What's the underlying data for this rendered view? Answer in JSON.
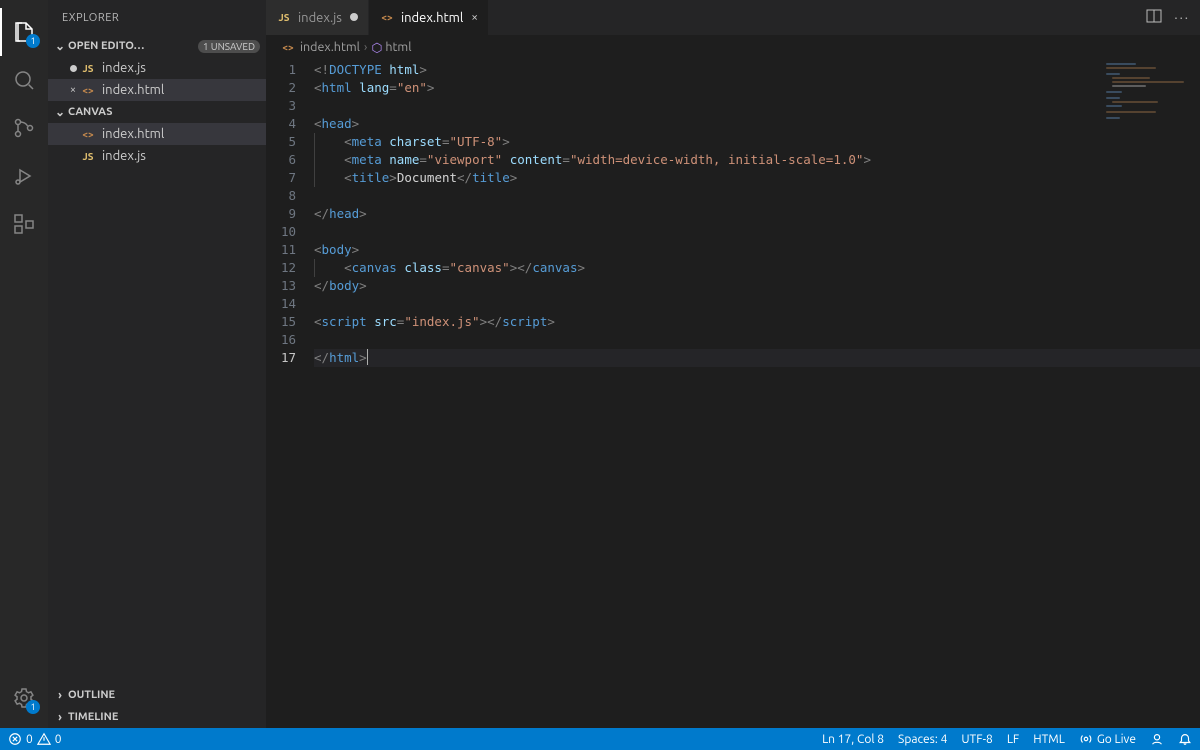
{
  "sidebar": {
    "title": "EXPLORER",
    "sections": {
      "open_editors": {
        "label": "OPEN EDITO…",
        "pill": "1 UNSAVED"
      },
      "workspace": {
        "label": "CANVAS"
      },
      "outline": {
        "label": "OUTLINE"
      },
      "timeline": {
        "label": "TIMELINE"
      }
    },
    "open_editors_items": [
      {
        "name": "index.js",
        "icon": "js",
        "dirty": true,
        "active": false
      },
      {
        "name": "index.html",
        "icon": "html",
        "dirty": false,
        "active": true
      }
    ],
    "workspace_items": [
      {
        "name": "index.html",
        "icon": "html",
        "active": true
      },
      {
        "name": "index.js",
        "icon": "js",
        "active": false
      }
    ]
  },
  "activity_badges": {
    "explorer": "1",
    "settings": "1"
  },
  "tabs": [
    {
      "name": "index.js",
      "icon": "js",
      "dirty": true,
      "active": false
    },
    {
      "name": "index.html",
      "icon": "html",
      "dirty": false,
      "active": true
    }
  ],
  "breadcrumbs": {
    "file": "index.html",
    "symbol": "html"
  },
  "editor": {
    "line_count": 17,
    "current_line": 17,
    "lines": {
      "1": {
        "t": "doctype",
        "text": "<!DOCTYPE html>"
      },
      "2": {
        "t": "open",
        "tag": "html",
        "attrs": [
          [
            "lang",
            "en"
          ]
        ]
      },
      "3": {
        "t": "blank"
      },
      "4": {
        "t": "open",
        "tag": "head"
      },
      "5": {
        "t": "self",
        "indent": 1,
        "tag": "meta",
        "attrs": [
          [
            "charset",
            "UTF-8"
          ]
        ]
      },
      "6": {
        "t": "self",
        "indent": 1,
        "tag": "meta",
        "attrs": [
          [
            "name",
            "viewport"
          ],
          [
            "content",
            "width=device-width, initial-scale=1.0"
          ]
        ]
      },
      "7": {
        "t": "wrap",
        "indent": 1,
        "tag": "title",
        "inner": "Document"
      },
      "8": {
        "t": "blank"
      },
      "9": {
        "t": "close",
        "tag": "head"
      },
      "10": {
        "t": "blank"
      },
      "11": {
        "t": "open",
        "tag": "body"
      },
      "12": {
        "t": "wrap",
        "indent": 1,
        "tag": "canvas",
        "attrs": [
          [
            "class",
            "canvas"
          ]
        ],
        "inner": ""
      },
      "13": {
        "t": "close",
        "tag": "body"
      },
      "14": {
        "t": "blank"
      },
      "15": {
        "t": "wrap",
        "tag": "script",
        "attrs": [
          [
            "src",
            "index.js"
          ]
        ],
        "inner": ""
      },
      "16": {
        "t": "blank"
      },
      "17": {
        "t": "close",
        "tag": "html",
        "cursor": true
      }
    }
  },
  "status": {
    "errors": "0",
    "warnings": "0",
    "cursor": "Ln 17, Col 8",
    "spaces": "Spaces: 4",
    "encoding": "UTF-8",
    "eol": "LF",
    "language": "HTML",
    "golive": "Go Live"
  }
}
